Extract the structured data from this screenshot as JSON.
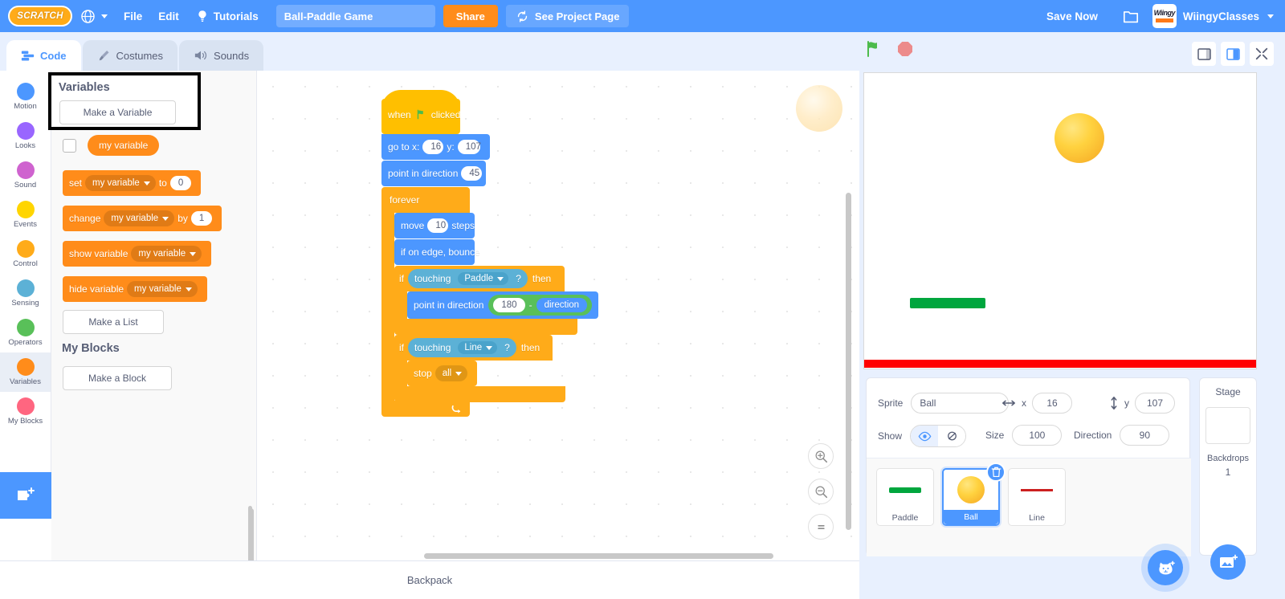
{
  "menubar": {
    "logo_text": "SCRATCH",
    "language_icon": "globe-icon",
    "file_label": "File",
    "edit_label": "Edit",
    "tutorials_label": "Tutorials",
    "tutorials_icon": "lightbulb-icon",
    "project_title": "Ball-Paddle Game",
    "project_title_placeholder": "Project title",
    "share_label": "Share",
    "project_page_label": "See Project Page",
    "project_page_icon": "refresh-icon",
    "save_now_label": "Save Now",
    "folder_icon": "folder-icon",
    "user_name": "WiingyClasses",
    "avatar_text": "Wiingy",
    "accent_blue": "#4c97ff",
    "accent_orange": "#ff8c1a"
  },
  "tabs": [
    {
      "label": "Code",
      "icon": "code-icon",
      "active": true
    },
    {
      "label": "Costumes",
      "icon": "paintbrush-icon",
      "active": false
    },
    {
      "label": "Sounds",
      "icon": "speaker-icon",
      "active": false
    }
  ],
  "stage_controls": {
    "green_flag_icon": "green-flag-icon",
    "stop_icon": "stop-sign-icon",
    "small_stage_icon": "small-stage-icon",
    "large_stage_icon": "large-stage-icon",
    "fullscreen_icon": "fullscreen-icon"
  },
  "categories": [
    {
      "label": "Motion",
      "color": "#4c97ff",
      "selected": false
    },
    {
      "label": "Looks",
      "color": "#9966ff",
      "selected": false
    },
    {
      "label": "Sound",
      "color": "#cf63cf",
      "selected": false
    },
    {
      "label": "Events",
      "color": "#ffd500",
      "selected": false
    },
    {
      "label": "Control",
      "color": "#ffab19",
      "selected": false
    },
    {
      "label": "Sensing",
      "color": "#5cb1d6",
      "selected": false
    },
    {
      "label": "Operators",
      "color": "#59c059",
      "selected": false
    },
    {
      "label": "Variables",
      "color": "#ff8c1a",
      "selected": true
    },
    {
      "label": "My Blocks",
      "color": "#ff6680",
      "selected": false
    }
  ],
  "add_extension_icon": "add-extension-icon",
  "palette": {
    "variables_heading": "Variables",
    "make_variable_label": "Make a Variable",
    "my_variable_label": "my variable",
    "set_label": "set",
    "set_to_label": "to",
    "set_value": "0",
    "change_label": "change",
    "change_by_label": "by",
    "change_value": "1",
    "show_variable_label": "show variable",
    "hide_variable_label": "hide variable",
    "make_list_label": "Make a List",
    "my_blocks_heading": "My Blocks",
    "make_block_label": "Make a Block"
  },
  "script": {
    "when_label": "when",
    "clicked_label": "clicked",
    "flag_icon": "green-flag-icon",
    "goto_label": "go to x:",
    "goto_x": "16",
    "goto_y_label": "y:",
    "goto_y": "107",
    "point_label": "point in direction",
    "point_value": "45",
    "forever_label": "forever",
    "move_label": "move",
    "move_value": "10",
    "steps_label": "steps",
    "bounce_label": "if on edge, bounce",
    "if_label": "if",
    "then_label": "then",
    "touching_label": "touching",
    "touching_paddle": "Paddle",
    "touching_line": "Line",
    "question_label": "?",
    "point2_label": "point in direction",
    "minus_left": "180",
    "minus_operator": "-",
    "minus_right": "direction",
    "stop_label": "stop",
    "stop_target": "all",
    "loop_arrow_icon": "loop-arrow-icon"
  },
  "zoom_controls": {
    "zoom_in_icon": "zoom-in-icon",
    "zoom_out_icon": "zoom-out-icon",
    "zoom_reset_icon": "zoom-reset-icon"
  },
  "stage": {
    "ball_sprite_icon": "ball-sprite",
    "paddle_sprite_icon": "paddle-sprite",
    "line_sprite_icon": "line-sprite",
    "paddle_color": "#00a63e",
    "line_color": "#ff0000",
    "ball_color": "#ffd23f"
  },
  "sprite_info": {
    "sprite_label": "Sprite",
    "sprite_name": "Ball",
    "x_label": "x",
    "x_value": "16",
    "x_icon": "arrows-horizontal-icon",
    "y_label": "y",
    "y_value": "107",
    "y_icon": "arrows-vertical-icon",
    "show_label": "Show",
    "show_on_icon": "eye-icon",
    "show_off_icon": "eye-slash-icon",
    "size_label": "Size",
    "size_value": "100",
    "direction_label": "Direction",
    "direction_value": "90"
  },
  "sprites": [
    {
      "name": "Paddle",
      "selected": false,
      "thumb": "paddle-thumb"
    },
    {
      "name": "Ball",
      "selected": true,
      "thumb": "ball-thumb"
    },
    {
      "name": "Line",
      "selected": false,
      "thumb": "line-thumb"
    }
  ],
  "delete_sprite_icon": "trash-icon",
  "stage_pane": {
    "title": "Stage",
    "backdrops_label": "Backdrops",
    "backdrops_count": "1"
  },
  "fabs": {
    "add_sprite_icon": "cat-add-icon",
    "add_backdrop_icon": "image-add-icon"
  },
  "backpack": {
    "label": "Backpack"
  }
}
